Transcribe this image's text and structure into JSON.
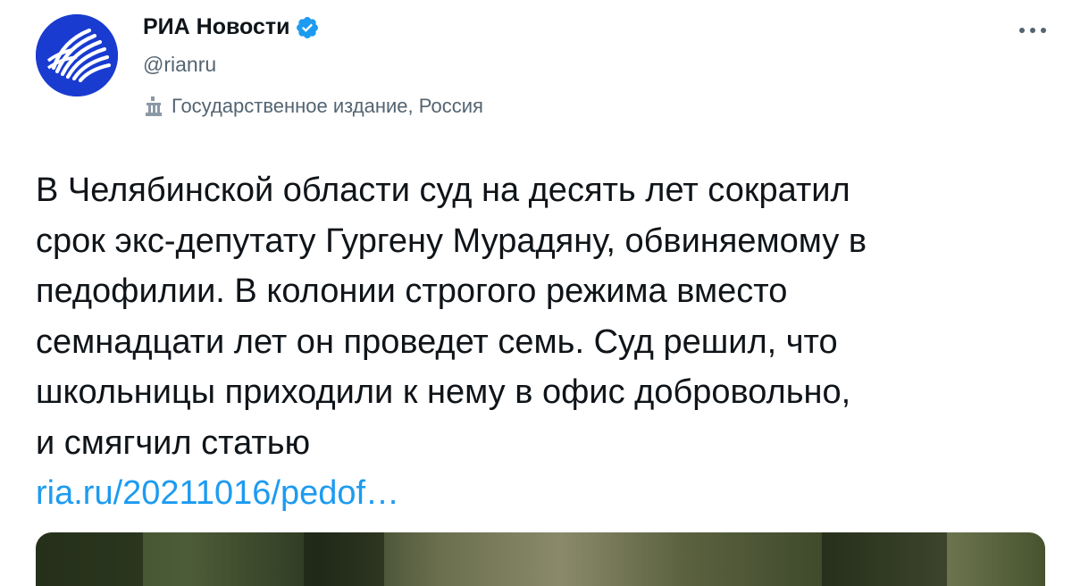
{
  "account": {
    "display_name": "РИА Новости",
    "handle": "@rianru",
    "label": "Государственное издание, Россия",
    "brand_color": "#1a3bd0",
    "verified_color": "#1d9bf0"
  },
  "icons": {
    "verified": "verified-badge-icon",
    "label": "state-media-icon",
    "more": "more-options-icon"
  },
  "tweet": {
    "lines": [
      "В Челябинской области суд на десять лет сократил",
      "срок экс-депутату Гургену Мурадяну, обвиняемому в",
      "педофилии. В колонии строгого режима вместо",
      "семнадцати лет он проведет семь. Суд решил, что",
      "школьницы приходили к нему в офис добровольно,",
      "и смягчил статью"
    ],
    "link_text": "ria.ru/20211016/pedof…"
  }
}
